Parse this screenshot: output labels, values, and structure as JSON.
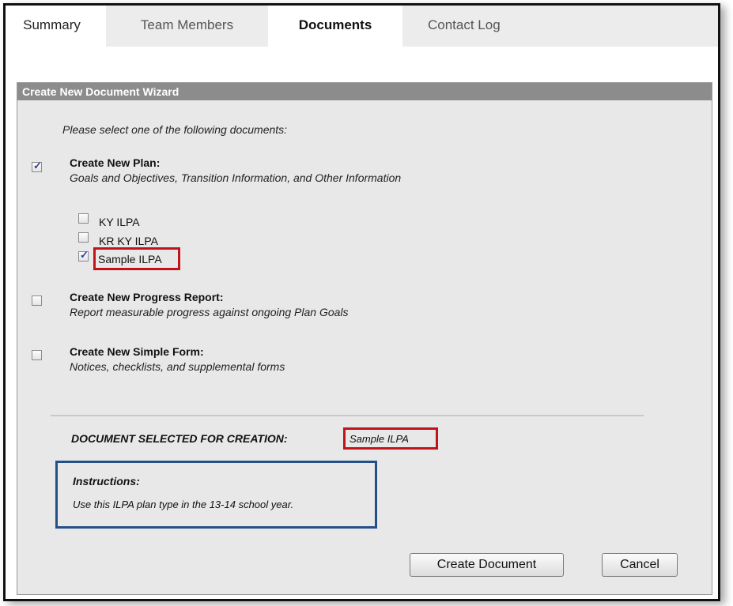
{
  "tabs": [
    {
      "label": "Summary"
    },
    {
      "label": "Team Members"
    },
    {
      "label": "Documents"
    },
    {
      "label": "Contact Log"
    }
  ],
  "wizard": {
    "title": "Create New Document Wizard",
    "intro": "Please select one of the following documents:",
    "plan": {
      "title": "Create New Plan:",
      "description": "Goals and Objectives, Transition Information, and Other Information",
      "checked": true,
      "options": [
        {
          "label": "KY ILPA",
          "checked": false
        },
        {
          "label": "KR KY ILPA",
          "checked": false
        },
        {
          "label": "Sample ILPA",
          "checked": true
        }
      ]
    },
    "progress_report": {
      "title": "Create New Progress Report:",
      "description": "Report measurable progress against ongoing Plan Goals",
      "checked": false
    },
    "simple_form": {
      "title": "Create New Simple Form:",
      "description": "Notices, checklists, and supplemental forms",
      "checked": false
    },
    "selected_label": "DOCUMENT SELECTED FOR CREATION:",
    "selected_value": "Sample ILPA",
    "instructions_title": "Instructions:",
    "instructions_text": "Use this ILPA plan type in the 13-14 school year.",
    "create_button": "Create Document",
    "cancel_button": "Cancel"
  },
  "colors": {
    "highlight_red": "#c0141a",
    "highlight_blue": "#24508a",
    "header_gray": "#8c8c8c",
    "panel_bg": "#e8e8e8"
  }
}
